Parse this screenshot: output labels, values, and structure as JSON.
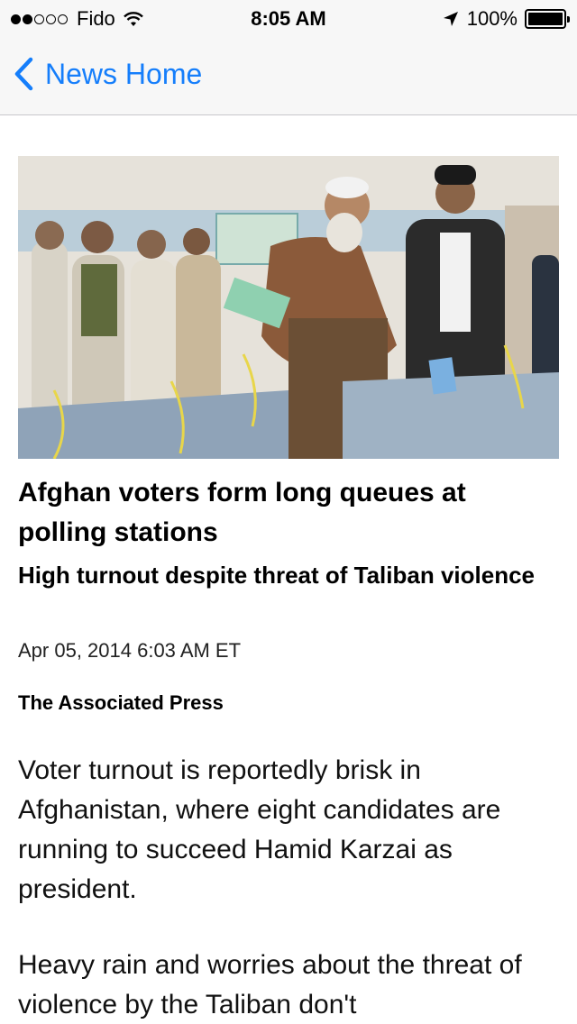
{
  "status_bar": {
    "carrier": "Fido",
    "time": "8:05 AM",
    "battery_text": "100%",
    "signal_bars_filled": 2,
    "signal_bars_total": 5,
    "battery_level": 1.0,
    "icons": [
      "signal-dots-icon",
      "wifi-icon",
      "location-arrow-icon",
      "battery-icon"
    ]
  },
  "nav": {
    "back_label": "News Home",
    "accent_color": "#157efb"
  },
  "article": {
    "headline": "Afghan voters form long queues at polling stations",
    "subheadline": "High turnout despite threat of Taliban violence",
    "date": "Apr 05, 2014 6:03 AM ET",
    "source": "The Associated Press",
    "paragraphs": [
      "Voter turnout is reportedly brisk in Afghanistan, where eight candidates are running to succeed Hamid Karzai as president.",
      "Heavy rain and worries about the threat of violence by the Taliban don't"
    ]
  }
}
